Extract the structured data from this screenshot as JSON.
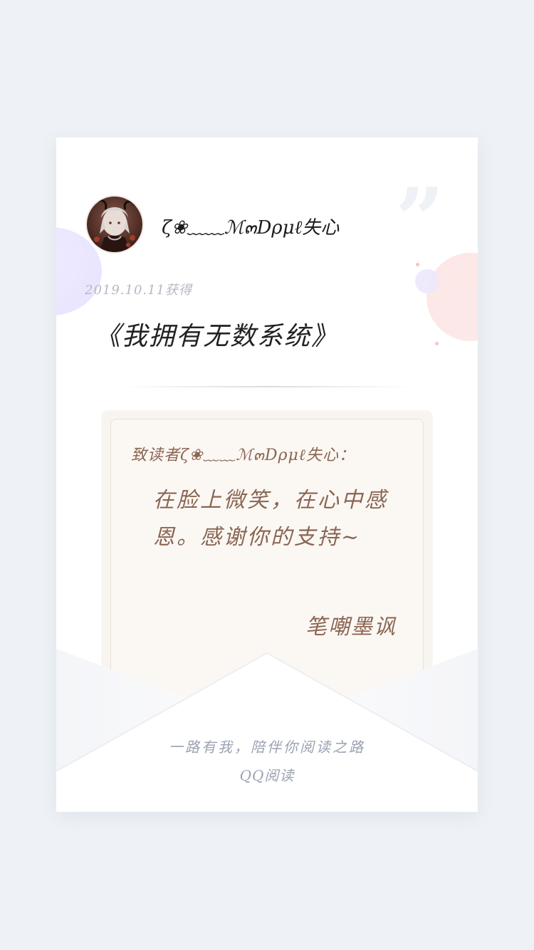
{
  "card": {
    "username": "ζ❀﹏﹏ℳ๓Dρμℓ失心",
    "date": "2019.10.11获得",
    "book_title": "《我拥有无数系统》",
    "quote_mark": "”"
  },
  "letter": {
    "greeting": "致读者ζ❀﹏﹏ℳ๓Dρμℓ失心：",
    "message": "在脸上微笑，在心中感恩。感谢你的支持~",
    "signature": "笔嘲墨讽"
  },
  "footer": {
    "slogan": "一路有我，陪伴你阅读之路",
    "brand": "QQ阅读"
  },
  "colors": {
    "page_background": "#eef2f6",
    "card_background": "#ffffff",
    "letter_text": "#8b6552",
    "footer_text": "#9aa2b1"
  }
}
